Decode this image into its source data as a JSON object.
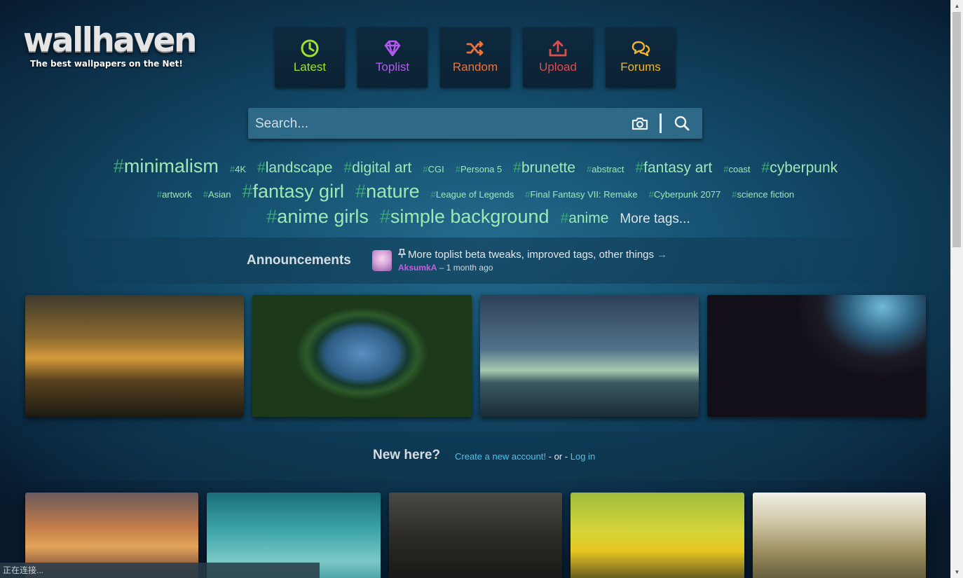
{
  "logo": {
    "title": "wallhaven",
    "tagline": "The best wallpapers on the Net!"
  },
  "nav": [
    {
      "label": "Latest",
      "icon": "clock-icon",
      "color": "#9ee231"
    },
    {
      "label": "Toplist",
      "icon": "diamond-icon",
      "color": "#b659f0"
    },
    {
      "label": "Random",
      "icon": "shuffle-icon",
      "color": "#f0723a"
    },
    {
      "label": "Upload",
      "icon": "upload-icon",
      "color": "#e04d4d"
    },
    {
      "label": "Forums",
      "icon": "chat-icon",
      "color": "#f0b52c"
    }
  ],
  "search": {
    "placeholder": "Search..."
  },
  "tags": {
    "row1": [
      "minimalism",
      "4K",
      "landscape",
      "digital art",
      "CGI",
      "Persona 5",
      "brunette",
      "abstract",
      "fantasy art",
      "coast",
      "cyberpunk"
    ],
    "row2": [
      "artwork",
      "Asian",
      "fantasy girl",
      "nature",
      "League of Legends",
      "Final Fantasy VII: Remake",
      "Cyberpunk 2077",
      "science fiction"
    ],
    "row3": [
      "anime girls",
      "simple background",
      "anime"
    ],
    "more": "More tags..."
  },
  "announcements": {
    "title": "Announcements",
    "link": "More toplist beta tweaks, improved tags, other things",
    "author": "AksumkA",
    "time": "– 1 month ago"
  },
  "newhere": {
    "title": "New here?",
    "create": "Create a new account!",
    "or": " - or - ",
    "login": "Log in"
  },
  "status": "正在连接..."
}
